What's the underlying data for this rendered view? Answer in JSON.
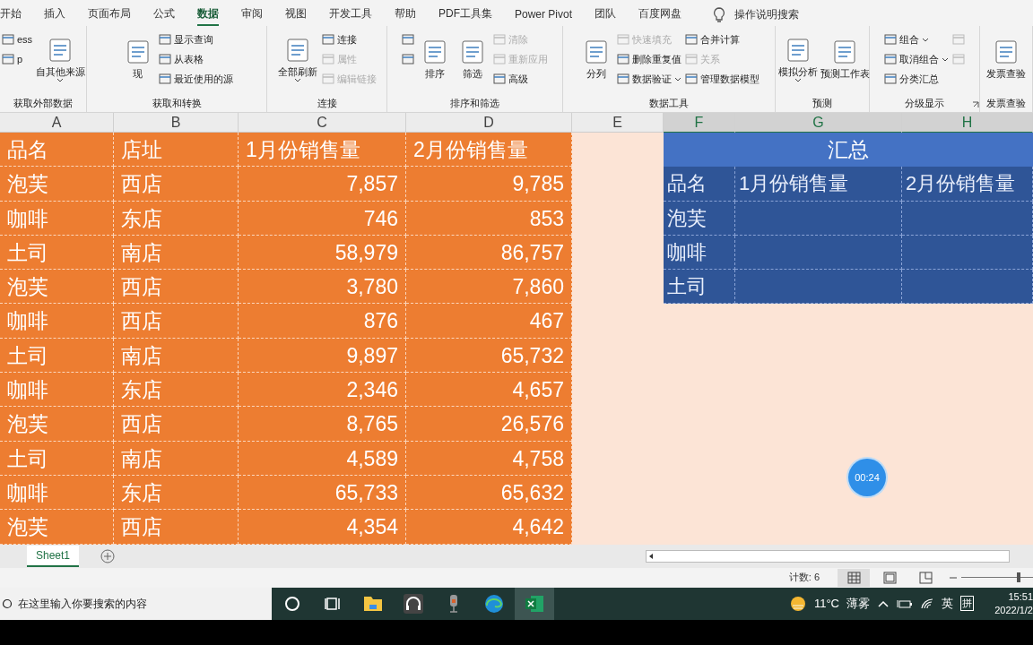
{
  "tabs": [
    {
      "label": "开始",
      "selected": false
    },
    {
      "label": "插入",
      "selected": false
    },
    {
      "label": "页面布局",
      "selected": false
    },
    {
      "label": "公式",
      "selected": false
    },
    {
      "label": "数据",
      "selected": true
    },
    {
      "label": "审阅",
      "selected": false
    },
    {
      "label": "视图",
      "selected": false
    },
    {
      "label": "开发工具",
      "selected": false
    },
    {
      "label": "帮助",
      "selected": false
    },
    {
      "label": "PDF工具集",
      "selected": false
    },
    {
      "label": "Power Pivot",
      "selected": false
    },
    {
      "label": "团队",
      "selected": false
    },
    {
      "label": "百度网盘",
      "selected": false
    }
  ],
  "tell_me": "操作说明搜索",
  "ribbon": [
    {
      "label": "获取外部数据",
      "items": [
        {
          "kind": "small",
          "label": "ess",
          "disabled": false
        },
        {
          "kind": "small",
          "label": "p",
          "disabled": false
        },
        {
          "kind": "large",
          "label": "自其他来源",
          "disabled": false,
          "menu": true
        }
      ]
    },
    {
      "label": "获取和转换",
      "items": [
        {
          "kind": "large",
          "label": "现",
          "disabled": false
        },
        {
          "kind": "small",
          "label": "显示查询",
          "disabled": false
        },
        {
          "kind": "small",
          "label": "从表格",
          "disabled": false
        },
        {
          "kind": "small",
          "label": "最近使用的源",
          "disabled": false
        }
      ]
    },
    {
      "label": "连接",
      "items": [
        {
          "kind": "large",
          "label": "全部刷新",
          "disabled": false,
          "menu": true
        },
        {
          "kind": "small",
          "label": "连接",
          "disabled": false
        },
        {
          "kind": "small",
          "label": "属性",
          "disabled": true
        },
        {
          "kind": "small",
          "label": "编辑链接",
          "disabled": true
        }
      ]
    },
    {
      "label": "排序和筛选",
      "items": [
        {
          "kind": "small",
          "disabled": false
        },
        {
          "kind": "small",
          "disabled": false
        },
        {
          "kind": "large",
          "label": "排序",
          "disabled": false
        },
        {
          "kind": "large",
          "label": "筛选",
          "disabled": false
        },
        {
          "kind": "small",
          "label": "清除",
          "disabled": true
        },
        {
          "kind": "small",
          "label": "重新应用",
          "disabled": true
        },
        {
          "kind": "small",
          "label": "高级",
          "disabled": false
        }
      ]
    },
    {
      "label": "数据工具",
      "items": [
        {
          "kind": "large",
          "label": "分列",
          "disabled": false
        },
        {
          "kind": "small",
          "label": "快速填充",
          "disabled": true
        },
        {
          "kind": "small",
          "label": "删除重复值",
          "disabled": false
        },
        {
          "kind": "small",
          "label": "数据验证",
          "disabled": false,
          "menu": true
        },
        {
          "kind": "small",
          "label": "合并计算",
          "disabled": false
        },
        {
          "kind": "small",
          "label": "关系",
          "disabled": true
        },
        {
          "kind": "small",
          "label": "管理数据模型",
          "disabled": false
        }
      ]
    },
    {
      "label": "预测",
      "items": [
        {
          "kind": "large",
          "label": "模拟分析",
          "disabled": false,
          "menu": true
        },
        {
          "kind": "large",
          "label": "预测工作表",
          "disabled": false
        }
      ]
    },
    {
      "label": "分级显示",
      "launcher": true,
      "items": [
        {
          "kind": "small",
          "label": "组合",
          "disabled": false,
          "menu": true
        },
        {
          "kind": "small",
          "label": "取消组合",
          "disabled": false,
          "menu": true
        },
        {
          "kind": "small",
          "label": "分类汇总",
          "disabled": false
        },
        {
          "kind": "small",
          "disabled": true
        },
        {
          "kind": "small",
          "disabled": true
        }
      ]
    },
    {
      "label": "发票查验",
      "items": [
        {
          "kind": "large",
          "label": "发票查验",
          "disabled": false
        }
      ]
    }
  ],
  "columns": [
    {
      "label": "A",
      "selected": false
    },
    {
      "label": "B",
      "selected": false
    },
    {
      "label": "C",
      "selected": false
    },
    {
      "label": "D",
      "selected": false
    },
    {
      "label": "E",
      "selected": false
    },
    {
      "label": "F",
      "selected": true
    },
    {
      "label": "G",
      "selected": true
    },
    {
      "label": "H",
      "selected": true
    }
  ],
  "table": {
    "columns": [
      "品名",
      "店址",
      "1月份销售量",
      "2月份销售量"
    ],
    "rows": [
      [
        "泡芙",
        "西店",
        "7,857",
        "9,785"
      ],
      [
        "咖啡",
        "东店",
        "746",
        "853"
      ],
      [
        "土司",
        "南店",
        "58,979",
        "86,757"
      ],
      [
        "泡芙",
        "西店",
        "3,780",
        "7,860"
      ],
      [
        "咖啡",
        "西店",
        "876",
        "467"
      ],
      [
        "土司",
        "南店",
        "9,897",
        "65,732"
      ],
      [
        "咖啡",
        "东店",
        "2,346",
        "4,657"
      ],
      [
        "泡芙",
        "西店",
        "8,765",
        "26,576"
      ],
      [
        "土司",
        "南店",
        "4,589",
        "4,758"
      ],
      [
        "咖啡",
        "东店",
        "65,733",
        "65,632"
      ],
      [
        "泡芙",
        "西店",
        "4,354",
        "4,642"
      ]
    ]
  },
  "summary": {
    "title": "汇总",
    "columns": [
      "品名",
      "1月份销售量",
      "2月份销售量"
    ],
    "rows": [
      "泡芙",
      "咖啡",
      "土司"
    ]
  },
  "timer": "00:24",
  "sheets": [
    {
      "label": "Sheet1",
      "selected": true
    }
  ],
  "status": {
    "count": "计数: 6",
    "zoom": {
      "level": 0.77
    }
  },
  "taskbar": {
    "search_placeholder": "在这里输入你要搜索的内容",
    "temperature": "11°C",
    "weather": "薄雾",
    "language": "英",
    "ime": "拼",
    "time": "15:51",
    "date": "2022/1/2"
  }
}
